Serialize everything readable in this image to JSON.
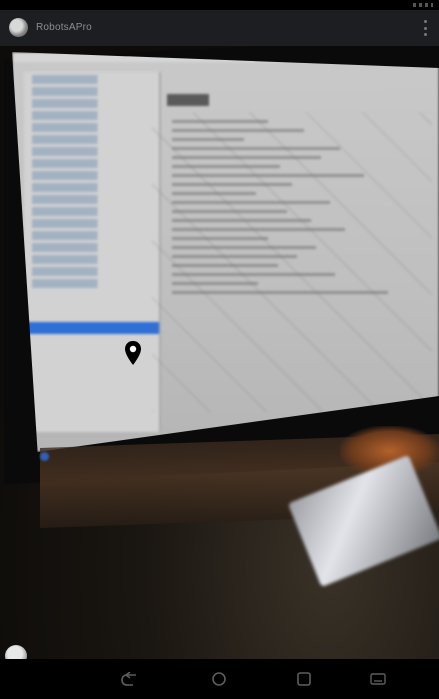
{
  "app_bar": {
    "title": "RobotsAPro",
    "avatar_icon": "avatar-icon",
    "menu_icon": "more-vertical-icon"
  },
  "camera_view": {
    "location_marker_icon": "map-pin-icon",
    "highlight_color": "#2f6fd6"
  },
  "navigation": {
    "buttons": [
      "back-icon",
      "home-icon",
      "recent-apps-icon",
      "keyboard-icon"
    ]
  }
}
